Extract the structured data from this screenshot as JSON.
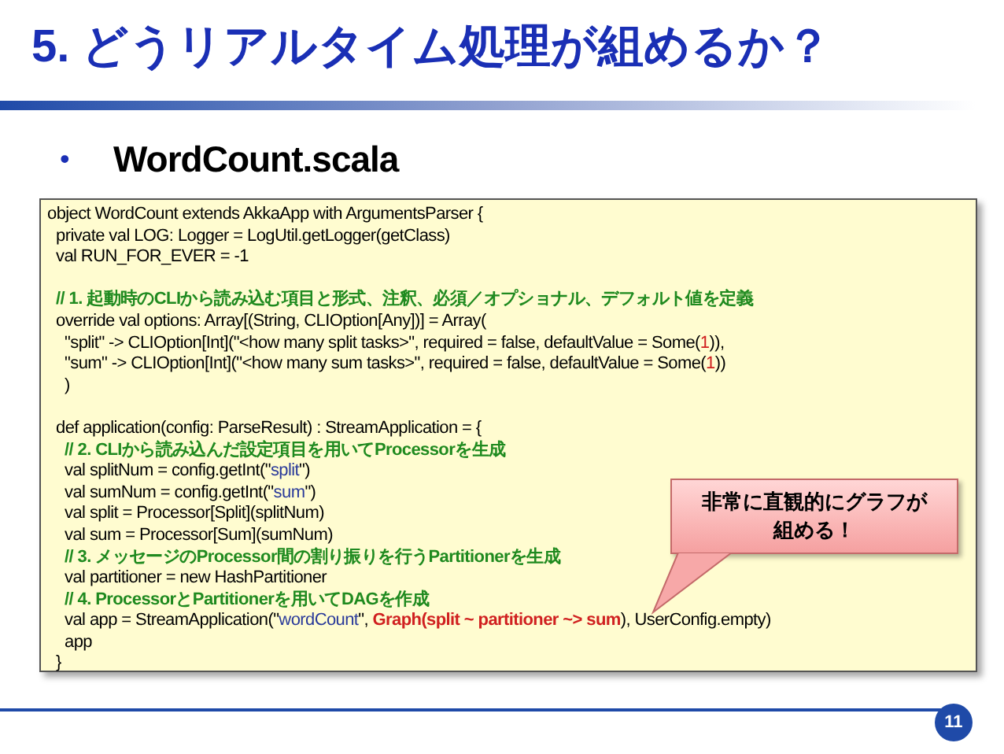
{
  "title": "5. どうリアルタイム処理が組めるか？",
  "bullet": {
    "marker": "•",
    "text": "WordCount.scala"
  },
  "code_blocks": [
    [
      [
        {
          "kind": "plain",
          "text": "object WordCount extends AkkaApp with ArgumentsParser {"
        }
      ],
      [
        {
          "kind": "plain",
          "text": "  private val LOG: Logger = LogUtil.getLogger(getClass)"
        }
      ],
      [
        {
          "kind": "plain",
          "text": "  val RUN_FOR_EVER = -1"
        }
      ]
    ],
    [
      [
        {
          "kind": "comment",
          "text": "  // 1. 起動時のCLIから読み込む項目と形式、注釈、必須／オプショナル、デフォルト値を定義"
        }
      ],
      [
        {
          "kind": "plain",
          "text": "  override val options: Array[(String, CLIOption[Any])] = Array("
        }
      ],
      [
        {
          "kind": "plain",
          "text": "    \"split\" -> CLIOption[Int](\"<how many split tasks>\", required = false, defaultValue = Some("
        },
        {
          "kind": "number",
          "text": "1"
        },
        {
          "kind": "plain",
          "text": ")),"
        }
      ],
      [
        {
          "kind": "plain",
          "text": "    \"sum\" -> CLIOption[Int](\"<how many sum tasks>\", required = false, defaultValue = Some("
        },
        {
          "kind": "number",
          "text": "1"
        },
        {
          "kind": "plain",
          "text": "))"
        }
      ],
      [
        {
          "kind": "plain",
          "text": "    )"
        }
      ]
    ],
    [
      [
        {
          "kind": "plain",
          "text": "  def application(config: ParseResult) : StreamApplication = {"
        }
      ],
      [
        {
          "kind": "comment",
          "text": "    // 2. CLIから読み込んだ設定項目を用いてProcessorを生成"
        }
      ],
      [
        {
          "kind": "plain",
          "text": "    val splitNum = config.getInt(\""
        },
        {
          "kind": "string",
          "text": "split"
        },
        {
          "kind": "plain",
          "text": "\")"
        }
      ],
      [
        {
          "kind": "plain",
          "text": "    val sumNum = config.getInt(\""
        },
        {
          "kind": "string",
          "text": "sum"
        },
        {
          "kind": "plain",
          "text": "\")"
        }
      ],
      [
        {
          "kind": "plain",
          "text": "    val split = Processor[Split](splitNum)"
        }
      ],
      [
        {
          "kind": "plain",
          "text": "    val sum = Processor[Sum](sumNum)"
        }
      ],
      [
        {
          "kind": "comment",
          "text": "    // 3. メッセージのProcessor間の割り振りを行うPartitionerを生成"
        }
      ],
      [
        {
          "kind": "plain",
          "text": "    val partitioner = new HashPartitioner"
        }
      ],
      [
        {
          "kind": "comment",
          "text": "    // 4. ProcessorとPartitionerを用いてDAGを作成"
        }
      ],
      [
        {
          "kind": "plain",
          "text": "    val app = StreamApplication(\""
        },
        {
          "kind": "string",
          "text": "wordCount"
        },
        {
          "kind": "plain",
          "text": "\", "
        },
        {
          "kind": "highlight",
          "text": "Graph(split ~ partitioner ~> sum"
        },
        {
          "kind": "plain",
          "text": "), UserConfig.empty)"
        }
      ],
      [
        {
          "kind": "plain",
          "text": "    app"
        }
      ],
      [
        {
          "kind": "plain",
          "text": "  }"
        }
      ]
    ]
  ],
  "callout": {
    "lines": [
      "非常に直観的にグラフが",
      "組める！"
    ]
  },
  "page_number": "11"
}
